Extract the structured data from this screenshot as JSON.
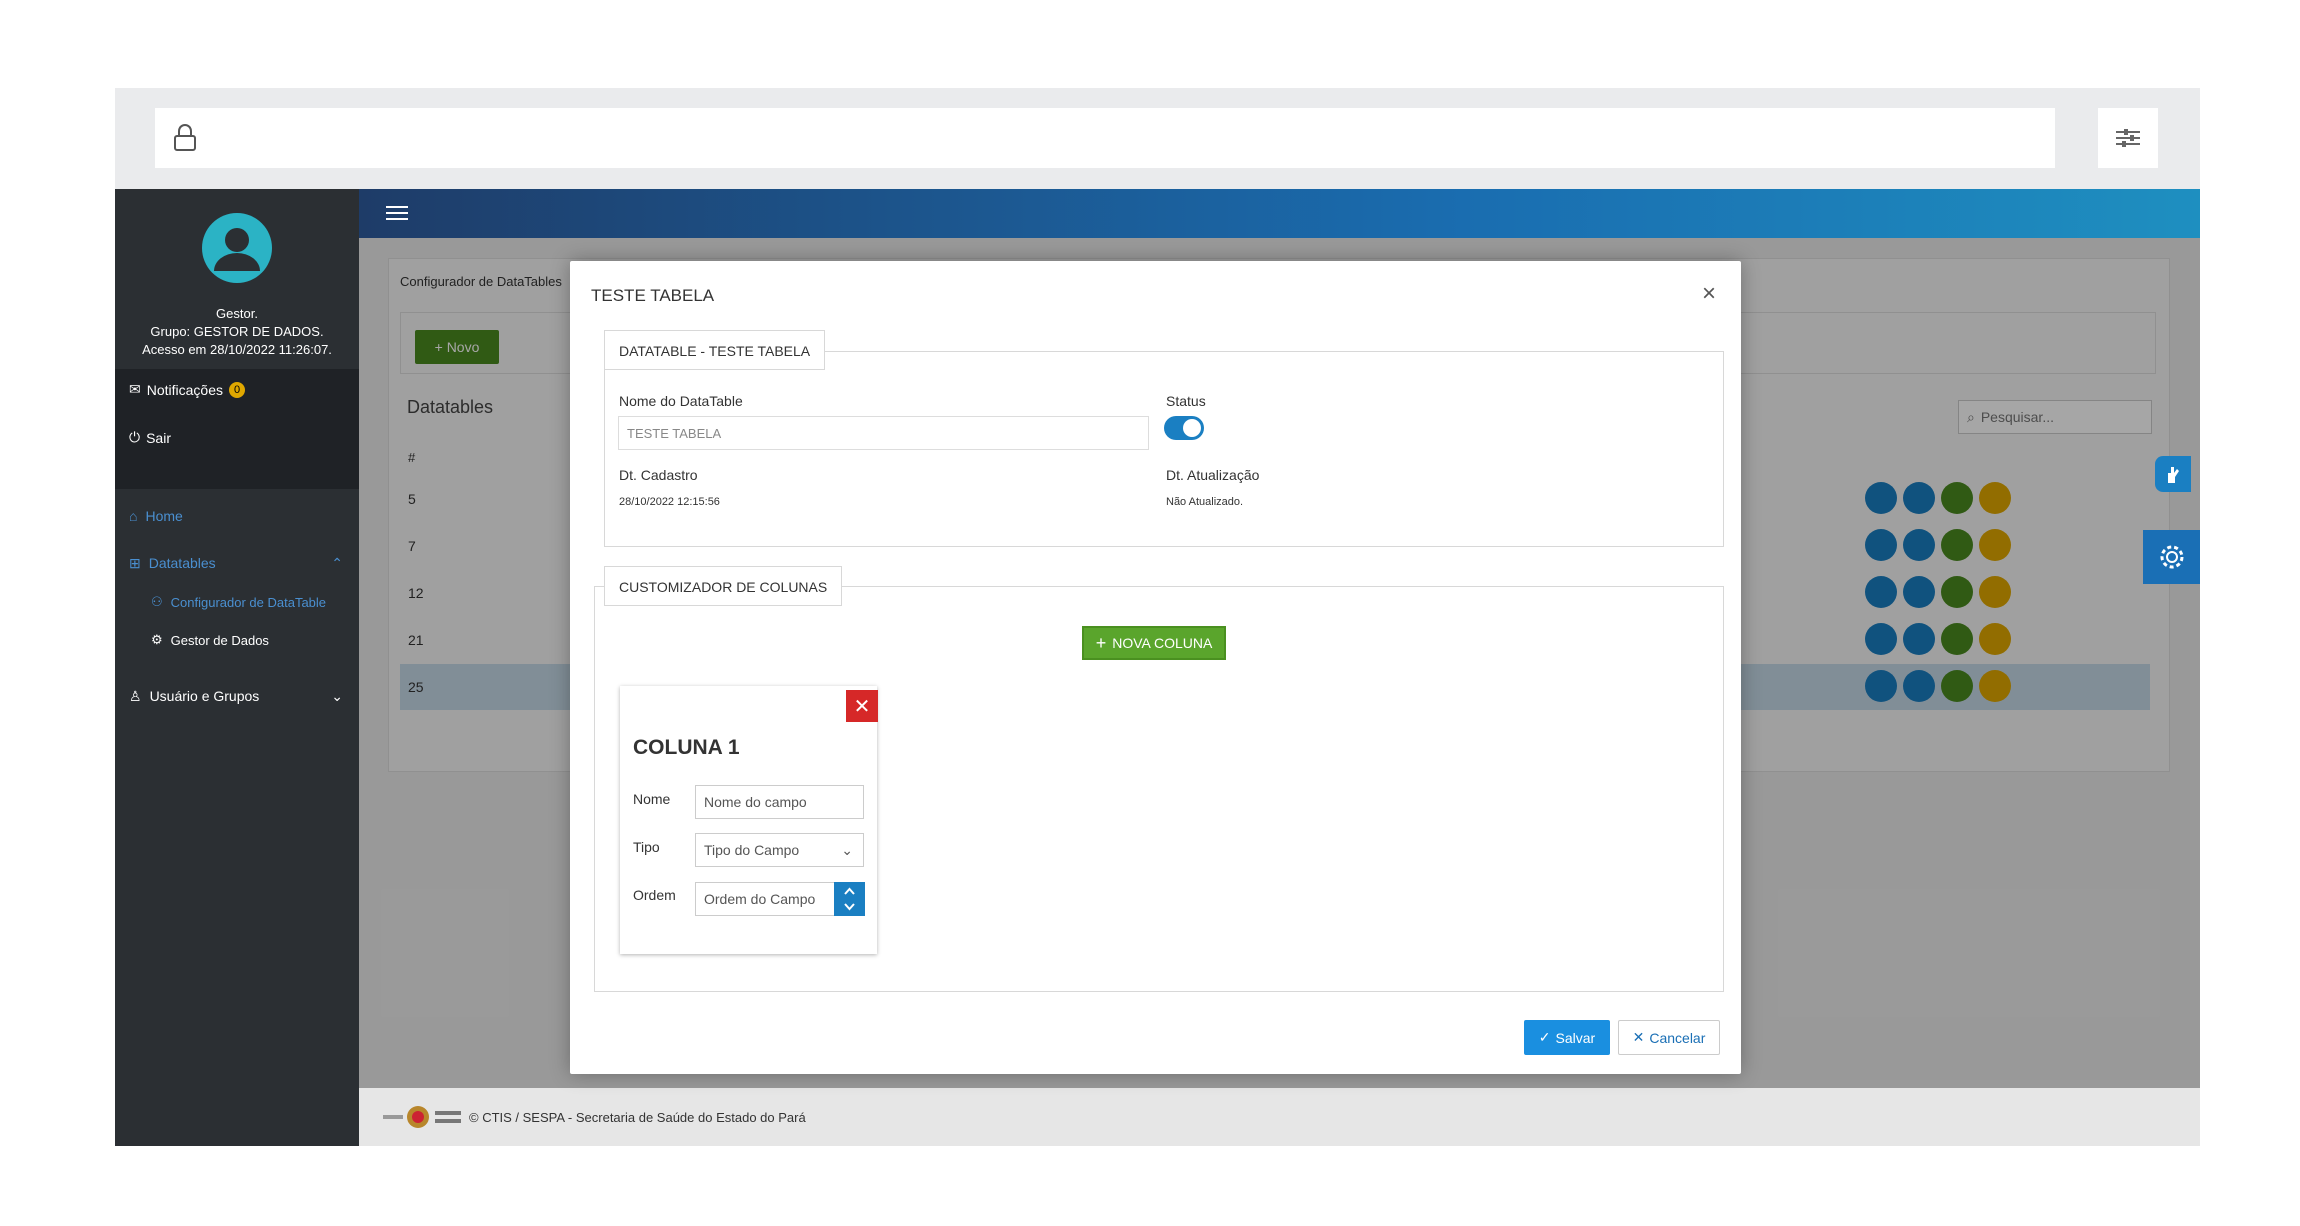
{
  "sidebar": {
    "user_name": "Gestor.",
    "user_group": "Grupo: GESTOR DE DADOS.",
    "user_access": "Acesso em 28/10/2022 11:26:07.",
    "notifications_label": "Notificações",
    "notifications_count": "0",
    "logout_label": "Sair",
    "menu": {
      "home": "Home",
      "datatables": "Datatables",
      "configurador": "Configurador de DataTable",
      "gestor": "Gestor de Dados",
      "usuarios": "Usuário e Grupos"
    }
  },
  "page": {
    "card_title": "Configurador de DataTables",
    "novo_label": "+ Novo",
    "heading": "Datatables",
    "search_placeholder": "Pesquisar...",
    "col_hash": "#",
    "rows": [
      "5",
      "7",
      "12",
      "21",
      "25"
    ],
    "footer": "© CTIS / SESPA - Secretaria de Saúde do Estado do Pará"
  },
  "modal": {
    "title": "TESTE TABELA",
    "section1_legend": "DATATABLE - TESTE TABELA",
    "nome_label": "Nome do DataTable",
    "nome_value": "TESTE TABELA",
    "status_label": "Status",
    "status_on": true,
    "cadastro_label": "Dt. Cadastro",
    "cadastro_value": "28/10/2022 12:15:56",
    "atualizacao_label": "Dt. Atualização",
    "atualizacao_value": "Não Atualizado.",
    "section2_legend": "CUSTOMIZADOR DE COLUNAS",
    "nova_coluna_label": "NOVA COLUNA",
    "column": {
      "title": "COLUNA 1",
      "nome_label": "Nome",
      "nome_placeholder": "Nome do campo",
      "tipo_label": "Tipo",
      "tipo_value": "Tipo do Campo",
      "ordem_label": "Ordem",
      "ordem_placeholder": "Ordem do Campo"
    },
    "salvar_label": "Salvar",
    "cancelar_label": "Cancelar"
  },
  "colors": {
    "primary": "#1a7fc2",
    "success": "#4b8b1f",
    "warning": "#e0a800",
    "danger": "#d62828"
  }
}
